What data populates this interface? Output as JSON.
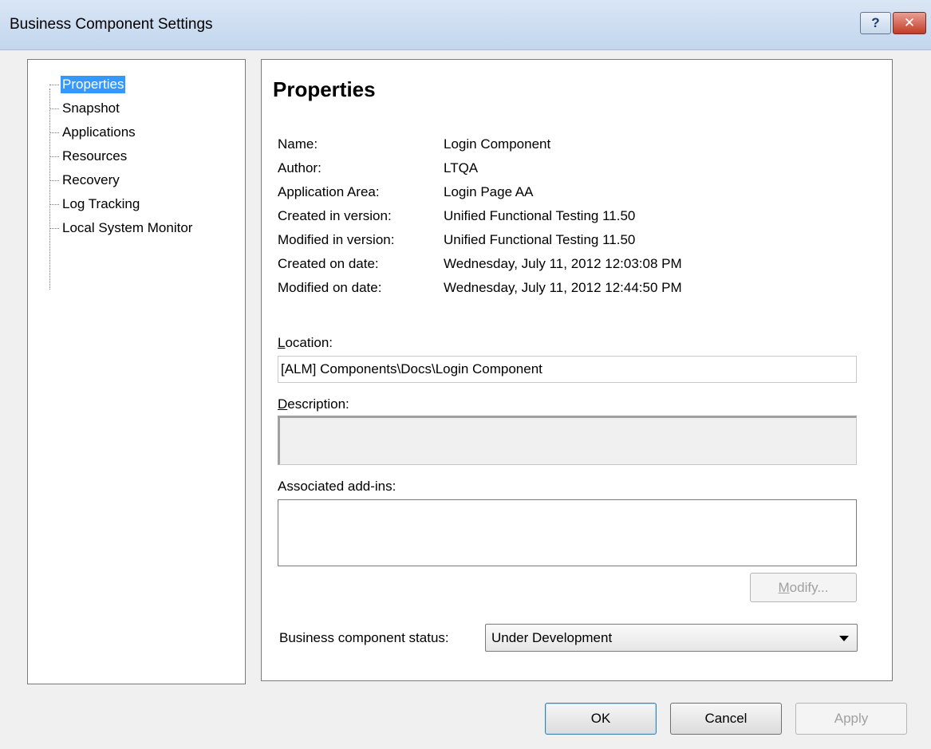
{
  "window": {
    "title": "Business Component Settings",
    "help_label": "?",
    "close_label": "✕"
  },
  "tree": {
    "items": [
      {
        "label": "Properties"
      },
      {
        "label": "Snapshot"
      },
      {
        "label": "Applications"
      },
      {
        "label": "Resources"
      },
      {
        "label": "Recovery"
      },
      {
        "label": "Log Tracking"
      },
      {
        "label": "Local System Monitor"
      }
    ]
  },
  "properties": {
    "heading": "Properties",
    "rows": [
      {
        "label": "Name:",
        "value": "Login Component"
      },
      {
        "label": "Author:",
        "value": "LTQA"
      },
      {
        "label": "Application Area:",
        "value": "Login Page AA"
      },
      {
        "label": "Created in version:",
        "value": "Unified Functional Testing 11.50"
      },
      {
        "label": "Modified in version:",
        "value": "Unified Functional Testing 11.50"
      },
      {
        "label": "Created on date:",
        "value": "Wednesday, July 11, 2012  12:03:08 PM"
      },
      {
        "label": "Modified on date:",
        "value": "Wednesday, July 11, 2012  12:44:50 PM"
      }
    ],
    "location_label_first": "L",
    "location_label_rest": "ocation:",
    "location_value": "[ALM] Components\\Docs\\Login Component",
    "description_label_first": "D",
    "description_label_rest": "escription:",
    "description_value": "",
    "addins_label": "Associated add-ins:",
    "modify_label_first": "M",
    "modify_label_rest": "odify...",
    "status_label": "Business component status:",
    "status_value": "Under Development"
  },
  "footer": {
    "ok_label": "OK",
    "cancel_label": "Cancel",
    "apply_label": "Apply"
  }
}
